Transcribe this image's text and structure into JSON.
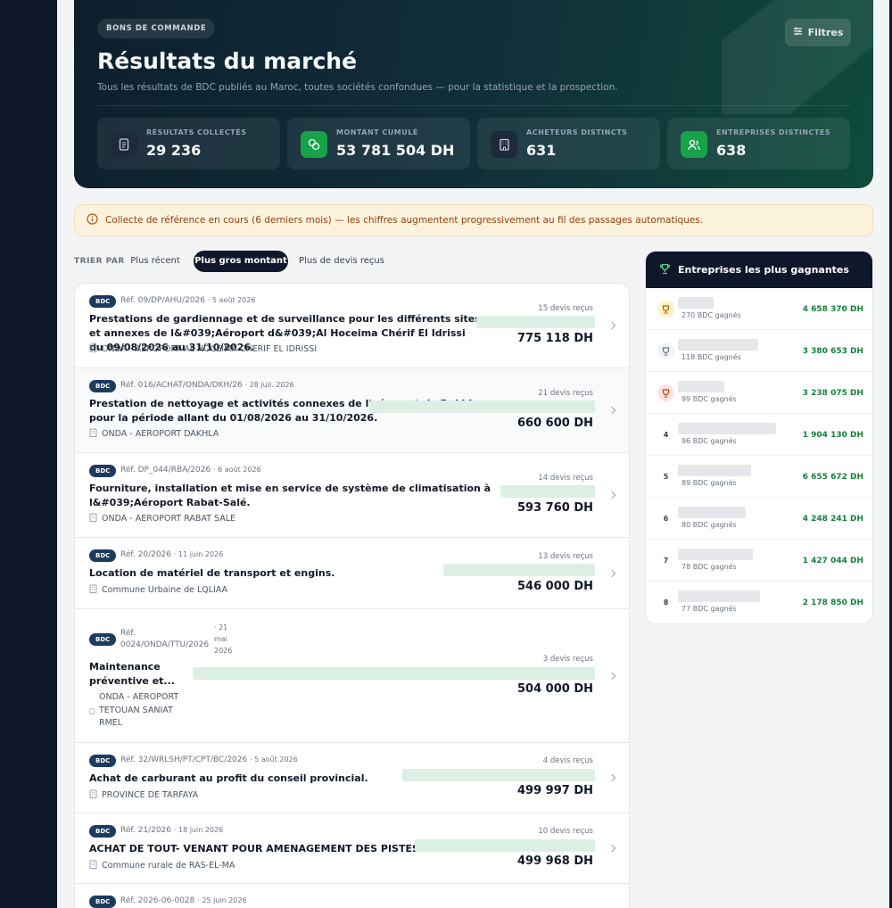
{
  "hero": {
    "badge": "BONS DE COMMANDE",
    "title": "Résultats du marché",
    "subtitle": "Tous les résultats de BDC publiés au Maroc, toutes sociétés confondues — pour la statistique et la prospection.",
    "filter_label": "Filtres",
    "stats": [
      {
        "label": "RÉSULTATS COLLECTÉS",
        "value": "29 236",
        "icon": "document-icon"
      },
      {
        "label": "MONTANT CUMULÉ",
        "value": "53 781 504 DH",
        "icon": "coins-icon"
      },
      {
        "label": "ACHETEURS DISTINCTS",
        "value": "631",
        "icon": "building-icon"
      },
      {
        "label": "ENTREPRISES DISTINCTES",
        "value": "638",
        "icon": "users-icon"
      }
    ]
  },
  "notice": "Collecte de référence en cours (6 derniers mois) — les chiffres augmentent progressivement au fil des passages automatiques.",
  "sort": {
    "label": "TRIER PAR",
    "options": [
      "Plus récent",
      "Plus gros montant",
      "Plus de devis reçus"
    ],
    "active": "Plus gros montant"
  },
  "results": [
    {
      "chip": "BDC",
      "ref": "Réf. 09/DP/AHU/2026",
      "date": "· 5 août 2026",
      "title": "Prestations de gardiennage et de surveillance pour les différents sites et annexes de l&#039;Aéroport d&#039;Al Hoceima Chérif El Idrissi du 09/08/2026 au 31/10/2026.",
      "buyer": "ONDA - AEROPORT AL HOCEIMA CHERIF EL IDRISSI",
      "quotes": "15 devis reçus",
      "amount": "775 118 DH",
      "share": 0.29
    },
    {
      "chip": "BDC",
      "ref": "Réf. 016/ACHAT/ONDA/DKH/26",
      "date": "· 28 juil. 2026",
      "title": "Prestation de nettoyage et activités connexes de l'aéroport de Dakhla pour la période allant du 01/08/2026 au 31/10/2026.",
      "buyer": "ONDA - AEROPORT DAKHLA",
      "quotes": "21 devis reçus",
      "amount": "660 600 DH",
      "share": 0.55
    },
    {
      "chip": "BDC",
      "ref": "Réf. DP_044/RBA/2026",
      "date": "· 6 août 2026",
      "title": "Fourniture, installation et mise en service de système de climatisation à l&#039;Aéroport Rabat-Salé.",
      "buyer": "ONDA - AEROPORT RABAT SALE",
      "quotes": "14 devis reçus",
      "amount": "593 760 DH",
      "share": 0.23
    },
    {
      "chip": "BDC",
      "ref": "Réf. 20/2026",
      "date": "· 11 juin 2026",
      "title": "Location de matériel de transport et engins.",
      "buyer": "Commune Urbaine de LQLIAA",
      "quotes": "13 devis reçus",
      "amount": "546 000 DH",
      "share": 0.37
    },
    {
      "chip": "BDC",
      "ref": "Réf. 0024/ONDA/TTU/2026",
      "date": "· 21 mai 2026",
      "title": "Maintenance préventive et...",
      "buyer": "ONDA - AEROPORT TETOUAN SANIAT RMEL",
      "quotes": "3 devis reçus",
      "amount": "504 000 DH",
      "share": 0.98
    },
    {
      "chip": "BDC",
      "ref": "Réf. 32/WRLSH/PT/CPT/BC/2026",
      "date": "· 5 août 2026",
      "title": "Achat de carburant au profit du conseil provincial.",
      "buyer": "PROVINCE DE TARFAYA",
      "quotes": "4 devis reçus",
      "amount": "499 997 DH",
      "share": 0.47
    },
    {
      "chip": "BDC",
      "ref": "Réf. 21/2026",
      "date": "· 18 juin 2026",
      "title": "ACHAT DE TOUT- VENANT POUR AMENAGEMENT DES PISTES",
      "buyer": "Commune rurale de RAS-EL-MA",
      "quotes": "10 devis reçus",
      "amount": "499 968 DH",
      "share": 0.44
    },
    {
      "chip": "BDC",
      "ref": "Réf. 2026-06-0028",
      "date": "· 25 juin 2026",
      "title": "",
      "buyer": "",
      "quotes": "",
      "amount": "",
      "share": 0
    }
  ],
  "winners": {
    "title": "Entreprises les plus gagnantes",
    "rows": [
      {
        "rank": "1",
        "count": "270 BDC gagnés",
        "amount": "4 658 370 DH",
        "medal": "gold"
      },
      {
        "rank": "2",
        "count": "118 BDC gagnés",
        "amount": "3 380 653 DH",
        "medal": "silver"
      },
      {
        "rank": "3",
        "count": "99 BDC gagnés",
        "amount": "3 238 075 DH",
        "medal": "bronze"
      },
      {
        "rank": "4",
        "count": "96 BDC gagnés",
        "amount": "1 904 130 DH",
        "medal": ""
      },
      {
        "rank": "5",
        "count": "89 BDC gagnés",
        "amount": "6 655 672 DH",
        "medal": ""
      },
      {
        "rank": "6",
        "count": "80 BDC gagnés",
        "amount": "4 248 241 DH",
        "medal": ""
      },
      {
        "rank": "7",
        "count": "78 BDC gagnés",
        "amount": "1 427 044 DH",
        "medal": ""
      },
      {
        "rank": "8",
        "count": "77 BDC gagnés",
        "amount": "2 178 850 DH",
        "medal": ""
      }
    ]
  },
  "colors": {
    "hero_start": "#0d1f2d",
    "hero_end": "#0f4b3a",
    "accent_green": "#15803d",
    "notice_bg": "#fbf2de",
    "navy": "#0f172a"
  }
}
